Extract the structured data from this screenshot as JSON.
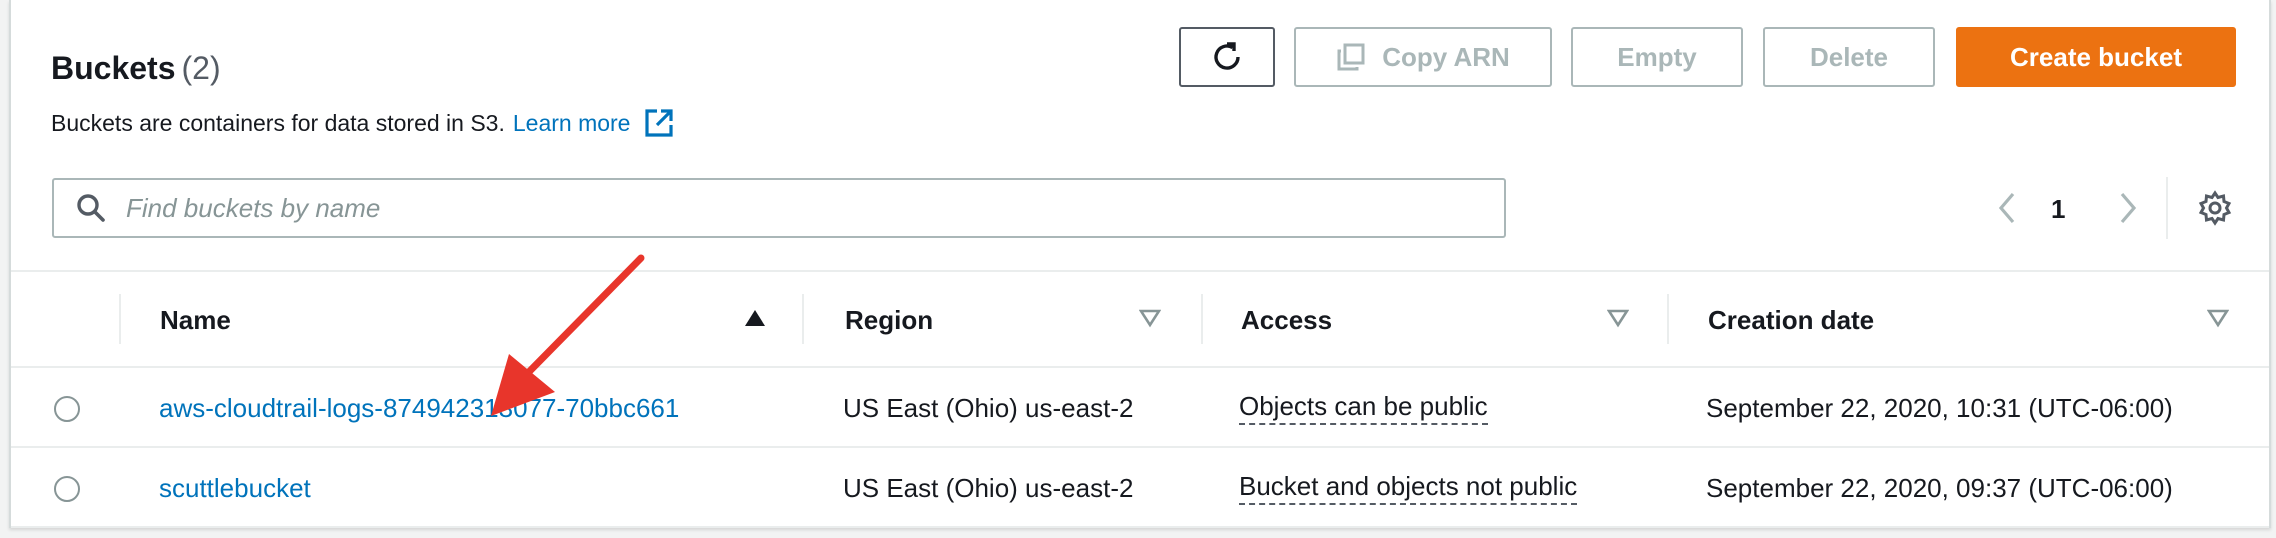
{
  "header": {
    "title": "Buckets",
    "count": "(2)",
    "description": "Buckets are containers for data stored in S3.",
    "learn_more": "Learn more"
  },
  "toolbar": {
    "copy_arn_label": "Copy ARN",
    "empty_label": "Empty",
    "delete_label": "Delete",
    "create_label": "Create bucket"
  },
  "search": {
    "placeholder": "Find buckets by name",
    "value": ""
  },
  "pagination": {
    "current_page": "1"
  },
  "table": {
    "columns": [
      "Name",
      "Region",
      "Access",
      "Creation date"
    ],
    "sort": {
      "column": "Name",
      "direction": "ascending"
    },
    "rows": [
      {
        "name": "aws-cloudtrail-logs-874942313077-70bbc661",
        "region": "US East (Ohio) us-east-2",
        "access": "Objects can be public",
        "created": "September 22, 2020, 10:31 (UTC-06:00)",
        "selected": false
      },
      {
        "name": "scuttlebucket",
        "region": "US East (Ohio) us-east-2",
        "access": "Bucket and objects not public",
        "created": "September 22, 2020, 09:37 (UTC-06:00)",
        "selected": false
      }
    ]
  },
  "colors": {
    "accent": "#ec7211",
    "link": "#0073bb",
    "annotation_arrow": "#e8352b",
    "disabled_text": "#aab7b8"
  },
  "icons": {
    "refresh": "refresh-icon",
    "copy": "copy-icon",
    "external_link": "external-link-icon",
    "search": "search-icon",
    "pager_prev": "chevron-left-icon",
    "pager_next": "chevron-right-icon",
    "settings": "gear-icon",
    "sort_ascending": "caret-up-icon",
    "sort_descending": "caret-down-outline-icon"
  }
}
